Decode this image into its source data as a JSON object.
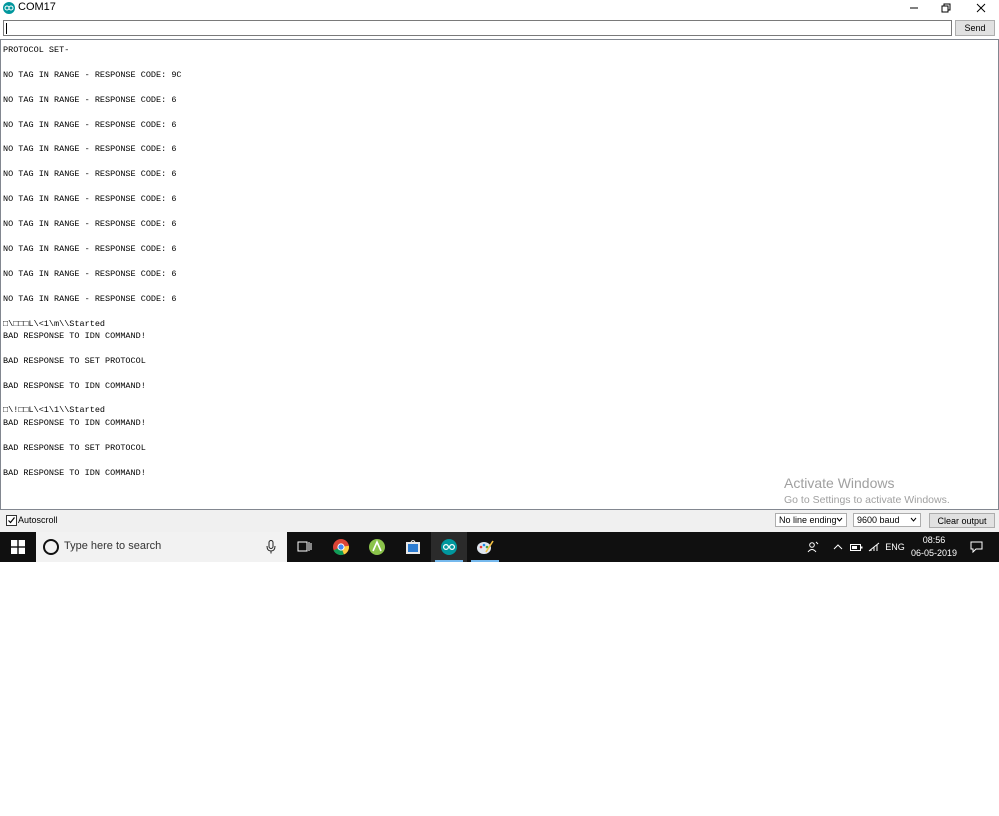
{
  "window": {
    "title": "COM17"
  },
  "input": {
    "value": "",
    "send_label": "Send"
  },
  "output": {
    "lines": [
      "PROTOCOL SET-",
      "NO TAG IN RANGE - RESPONSE CODE: 9C",
      "NO TAG IN RANGE - RESPONSE CODE: 6",
      "NO TAG IN RANGE - RESPONSE CODE: 6",
      "NO TAG IN RANGE - RESPONSE CODE: 6",
      "NO TAG IN RANGE - RESPONSE CODE: 6",
      "NO TAG IN RANGE - RESPONSE CODE: 6",
      "NO TAG IN RANGE - RESPONSE CODE: 6",
      "NO TAG IN RANGE - RESPONSE CODE: 6",
      "NO TAG IN RANGE - RESPONSE CODE: 6",
      "NO TAG IN RANGE - RESPONSE CODE: 6",
      "□\\□□□L\\<1\\m\\\\Started",
      "BAD RESPONSE TO IDN COMMAND!",
      "BAD RESPONSE TO SET PROTOCOL",
      "BAD RESPONSE TO IDN COMMAND!",
      "□\\!□□L\\<1\\1\\\\Started",
      "BAD RESPONSE TO IDN COMMAND!",
      "BAD RESPONSE TO SET PROTOCOL",
      "BAD RESPONSE TO IDN COMMAND!"
    ]
  },
  "watermark": {
    "title": "Activate Windows",
    "subtitle": "Go to Settings to activate Windows."
  },
  "bottom_bar": {
    "autoscroll_label": "Autoscroll",
    "autoscroll_checked": true,
    "line_ending": "No line ending",
    "baud": "9600 baud",
    "clear_label": "Clear output"
  },
  "taskbar": {
    "search_placeholder": "Type here to search",
    "language": "ENG",
    "time": "08:56",
    "date": "06-05-2019",
    "apps": [
      "task-view-icon",
      "chrome-icon",
      "android-studio-icon",
      "store-icon",
      "arduino-icon",
      "paint-icon"
    ]
  },
  "colors": {
    "taskbar_bg": "#101010",
    "arduino_teal": "#00979d",
    "active_underline": "#76b9ed"
  }
}
